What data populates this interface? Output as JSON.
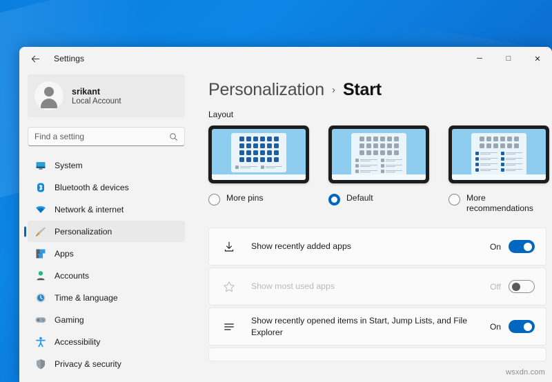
{
  "window": {
    "title": "Settings",
    "back_icon": "back-arrow-icon",
    "controls": {
      "minimize": "─",
      "maximize": "□",
      "close": "✕"
    }
  },
  "sidebar": {
    "profile": {
      "name": "srikant",
      "subtitle": "Local Account"
    },
    "search": {
      "placeholder": "Find a setting",
      "value": "",
      "icon": "search-icon"
    },
    "items": [
      {
        "label": "System",
        "icon": "monitor-icon",
        "active": false
      },
      {
        "label": "Bluetooth & devices",
        "icon": "bluetooth-icon",
        "active": false
      },
      {
        "label": "Network & internet",
        "icon": "wifi-icon",
        "active": false
      },
      {
        "label": "Personalization",
        "icon": "paintbrush-icon",
        "active": true
      },
      {
        "label": "Apps",
        "icon": "apps-icon",
        "active": false
      },
      {
        "label": "Accounts",
        "icon": "account-icon",
        "active": false
      },
      {
        "label": "Time & language",
        "icon": "clock-icon",
        "active": false
      },
      {
        "label": "Gaming",
        "icon": "gamepad-icon",
        "active": false
      },
      {
        "label": "Accessibility",
        "icon": "accessibility-icon",
        "active": false
      },
      {
        "label": "Privacy & security",
        "icon": "shield-icon",
        "active": false
      }
    ]
  },
  "main": {
    "breadcrumb": {
      "parent": "Personalization",
      "separator": "›",
      "current": "Start"
    },
    "section_label": "Layout",
    "layouts": [
      {
        "label": "More pins",
        "selected": false,
        "pin_rows": 4,
        "rec_rows": 1
      },
      {
        "label": "Default",
        "selected": true,
        "pin_rows": 3,
        "rec_rows": 3
      },
      {
        "label": "More recommendations",
        "selected": false,
        "pin_rows": 2,
        "rec_rows": 4
      }
    ],
    "settings": [
      {
        "title": "Show recently added apps",
        "icon": "download-icon",
        "state_label": "On",
        "on": true,
        "disabled": false
      },
      {
        "title": "Show most used apps",
        "icon": "star-icon",
        "state_label": "Off",
        "on": false,
        "disabled": true
      },
      {
        "title": "Show recently opened items in Start, Jump Lists, and File Explorer",
        "icon": "list-icon",
        "state_label": "On",
        "on": true,
        "disabled": false
      }
    ]
  },
  "watermark": "wsxdn.com",
  "colors": {
    "accent": "#0067c0",
    "desktop": "#0a7fe0",
    "surface": "#f3f3f3"
  }
}
